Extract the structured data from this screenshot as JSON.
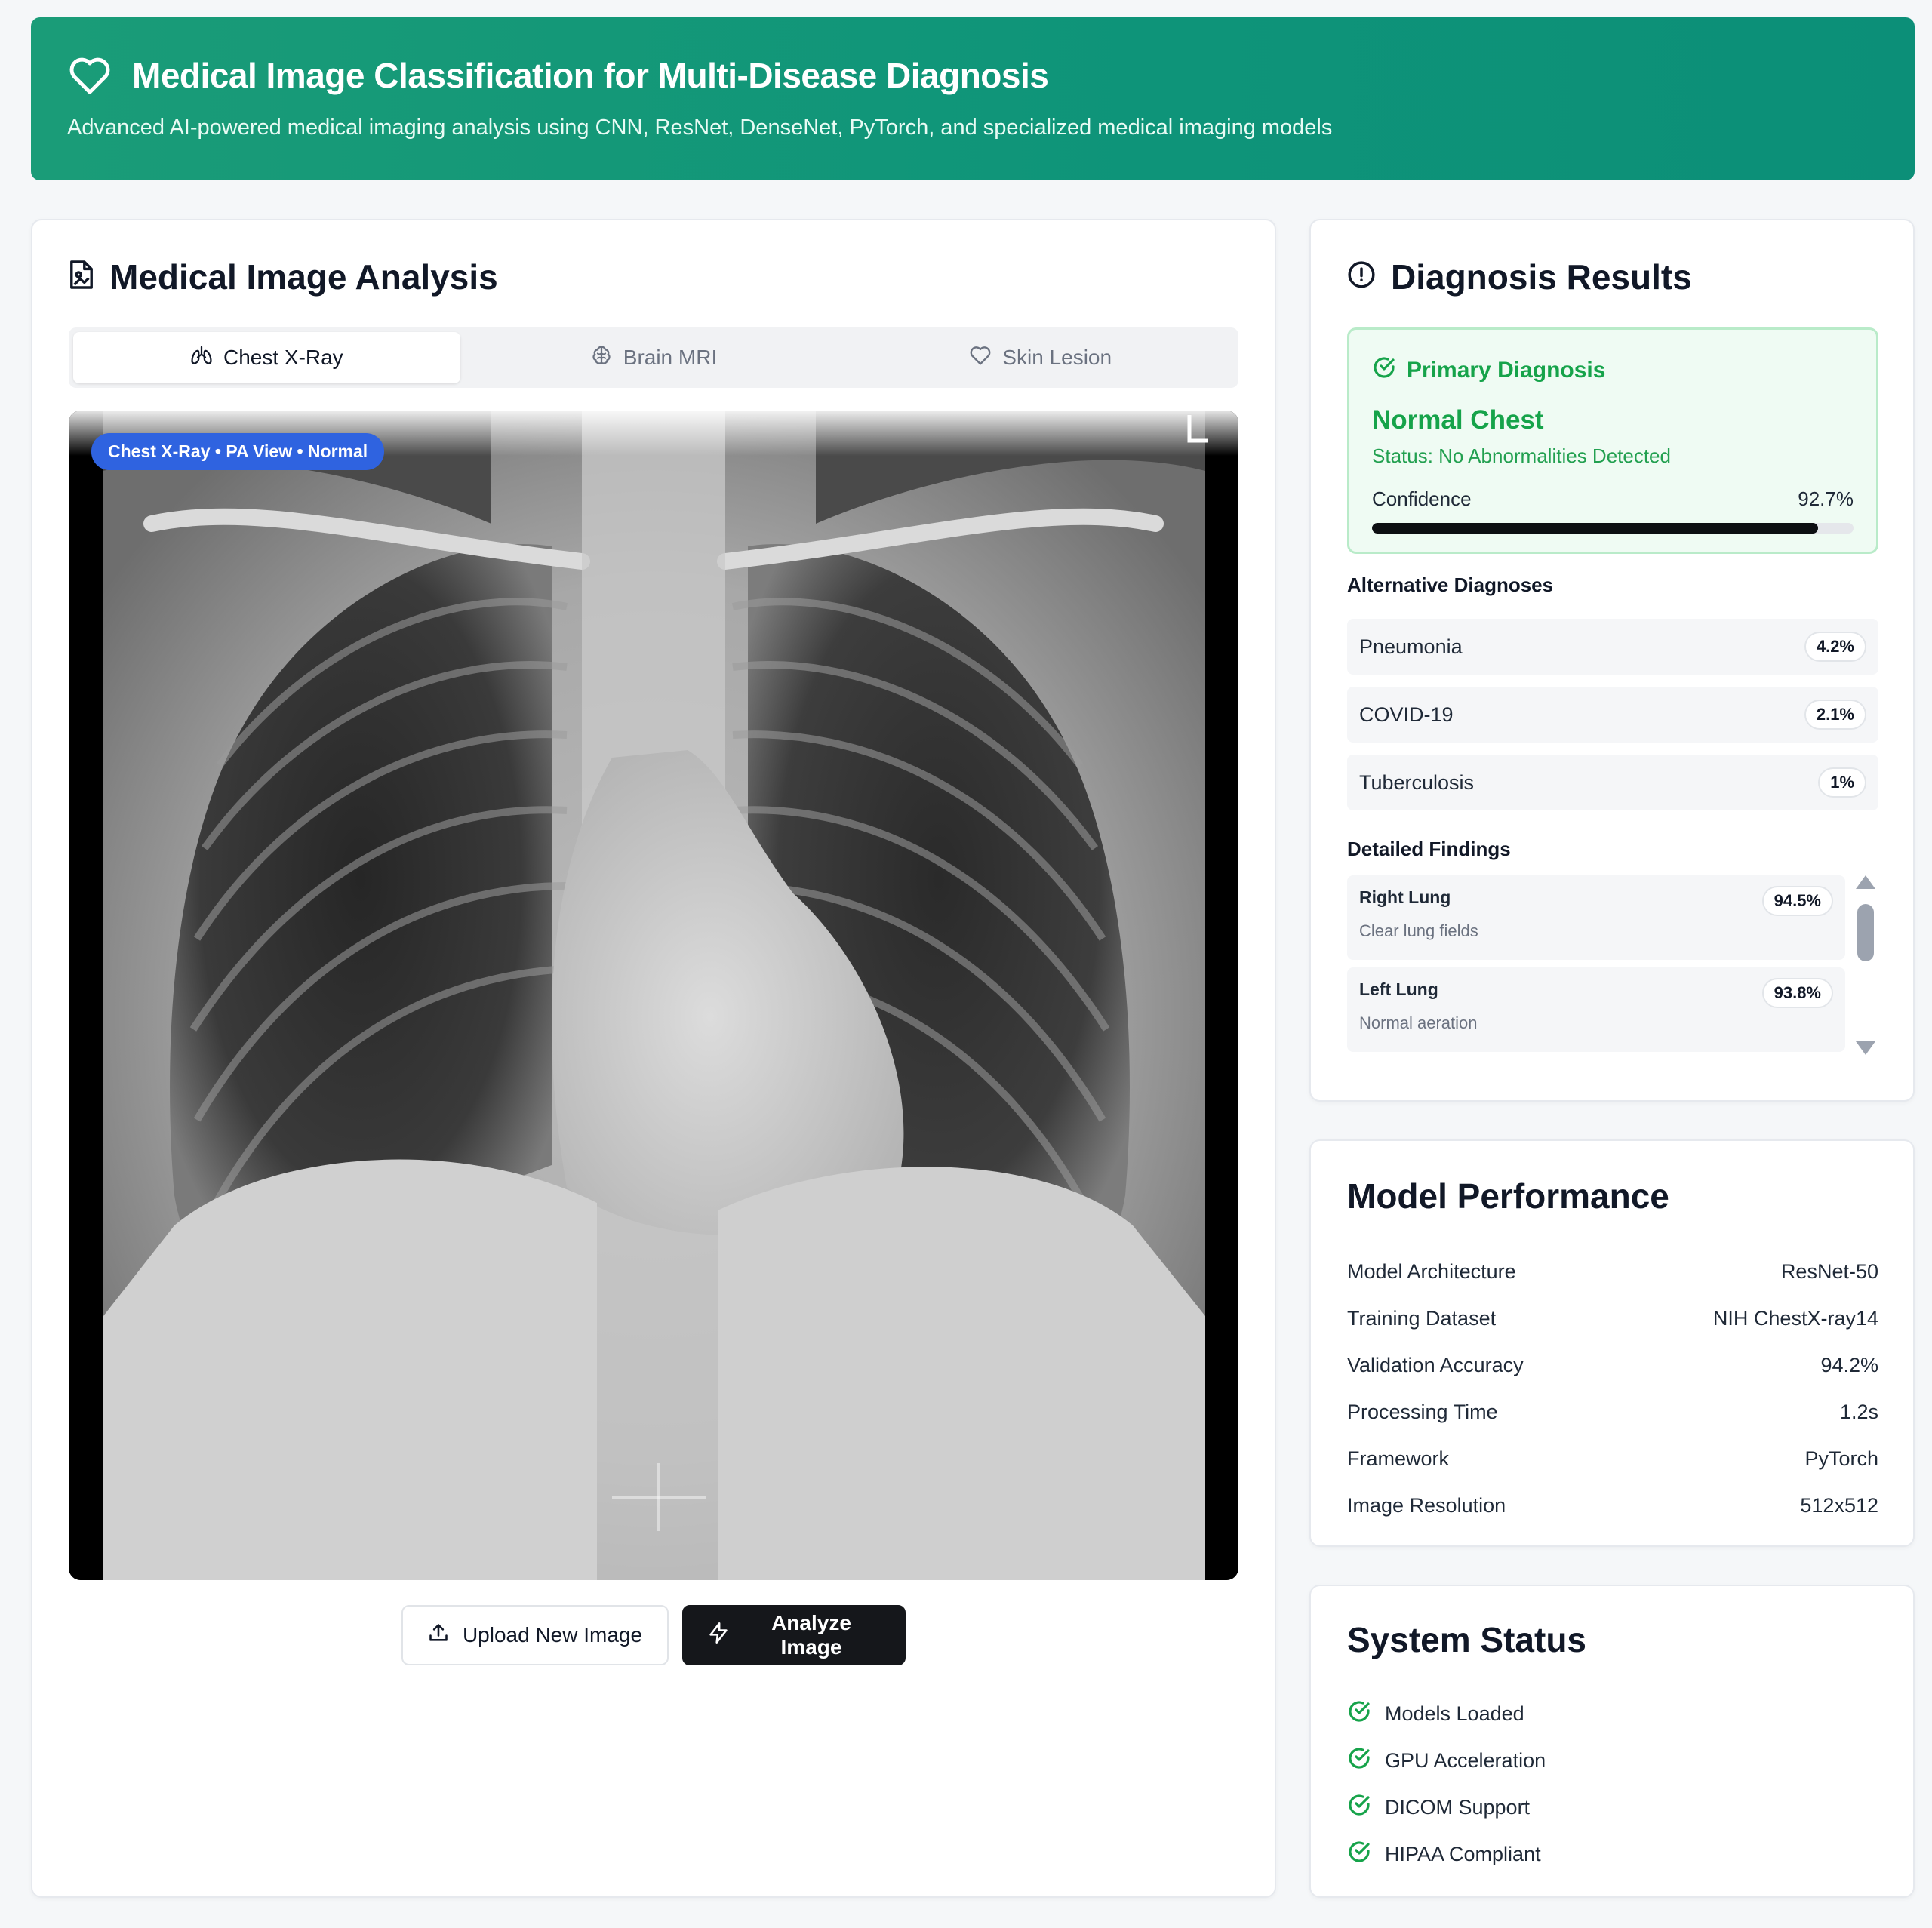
{
  "header": {
    "title": "Medical Image Classification for Multi-Disease Diagnosis",
    "subtitle": "Advanced AI-powered medical imaging analysis using CNN, ResNet, DenseNet, PyTorch, and specialized medical imaging models"
  },
  "analysis": {
    "title": "Medical Image Analysis",
    "tabs": [
      {
        "label": "Chest X-Ray",
        "icon": "lungs-icon",
        "active": true
      },
      {
        "label": "Brain MRI",
        "icon": "brain-icon",
        "active": false
      },
      {
        "label": "Skin Lesion",
        "icon": "heart-icon",
        "active": false
      }
    ],
    "image_badge": "Chest X-Ray • PA View • Normal",
    "upload_label": "Upload New Image",
    "analyze_label": "Analyze Image"
  },
  "diagnosis": {
    "title": "Diagnosis Results",
    "primary_label": "Primary Diagnosis",
    "primary_name": "Normal Chest",
    "primary_status": "Status: No Abnormalities Detected",
    "confidence_label": "Confidence",
    "confidence_value": "92.7%",
    "confidence_fraction": 0.927,
    "alternatives_heading": "Alternative Diagnoses",
    "alternatives": [
      {
        "name": "Pneumonia",
        "value": "4.2%"
      },
      {
        "name": "COVID-19",
        "value": "2.1%"
      },
      {
        "name": "Tuberculosis",
        "value": "1%"
      }
    ],
    "findings_heading": "Detailed Findings",
    "findings": [
      {
        "name": "Right Lung",
        "value": "94.5%",
        "desc": "Clear lung fields"
      },
      {
        "name": "Left Lung",
        "value": "93.8%",
        "desc": "Normal aeration"
      }
    ]
  },
  "performance": {
    "title": "Model Performance",
    "rows": [
      {
        "label": "Model Architecture",
        "value": "ResNet-50"
      },
      {
        "label": "Training Dataset",
        "value": "NIH ChestX-ray14"
      },
      {
        "label": "Validation Accuracy",
        "value": "94.2%"
      },
      {
        "label": "Processing Time",
        "value": "1.2s"
      },
      {
        "label": "Framework",
        "value": "PyTorch"
      },
      {
        "label": "Image Resolution",
        "value": "512x512"
      }
    ]
  },
  "system": {
    "title": "System Status",
    "items": [
      "Models Loaded",
      "GPU Acceleration",
      "DICOM Support",
      "HIPAA Compliant"
    ]
  },
  "colors": {
    "header_green": "#0e9479",
    "success_green": "#16a34a",
    "badge_blue": "#2f63e0",
    "dark_button": "#15171b"
  }
}
